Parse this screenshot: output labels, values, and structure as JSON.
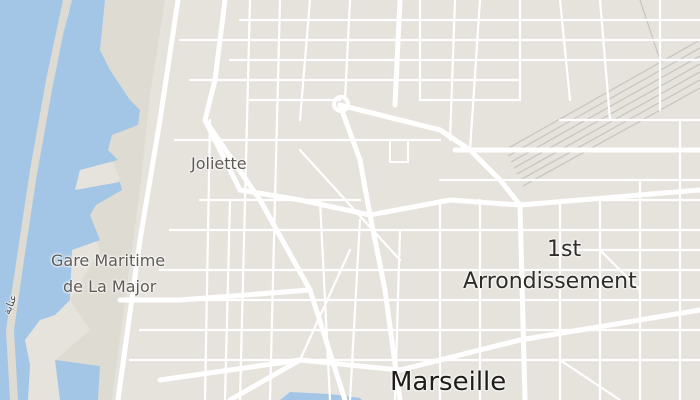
{
  "map": {
    "labels": {
      "joliette": "Joliette",
      "gare_line1": "Gare Maritime",
      "gare_line2": "de La Major",
      "arr_line1": "1st",
      "arr_line2": "Arrondissement",
      "marseille": "Marseille",
      "arabic": "عنابة"
    },
    "colors": {
      "water": "#a3c6e6",
      "land": "#e6e3dd",
      "port_land": "#dedbd3",
      "road": "#ffffff",
      "rail": "#c9c7c3",
      "label": "#5f5a55"
    }
  }
}
